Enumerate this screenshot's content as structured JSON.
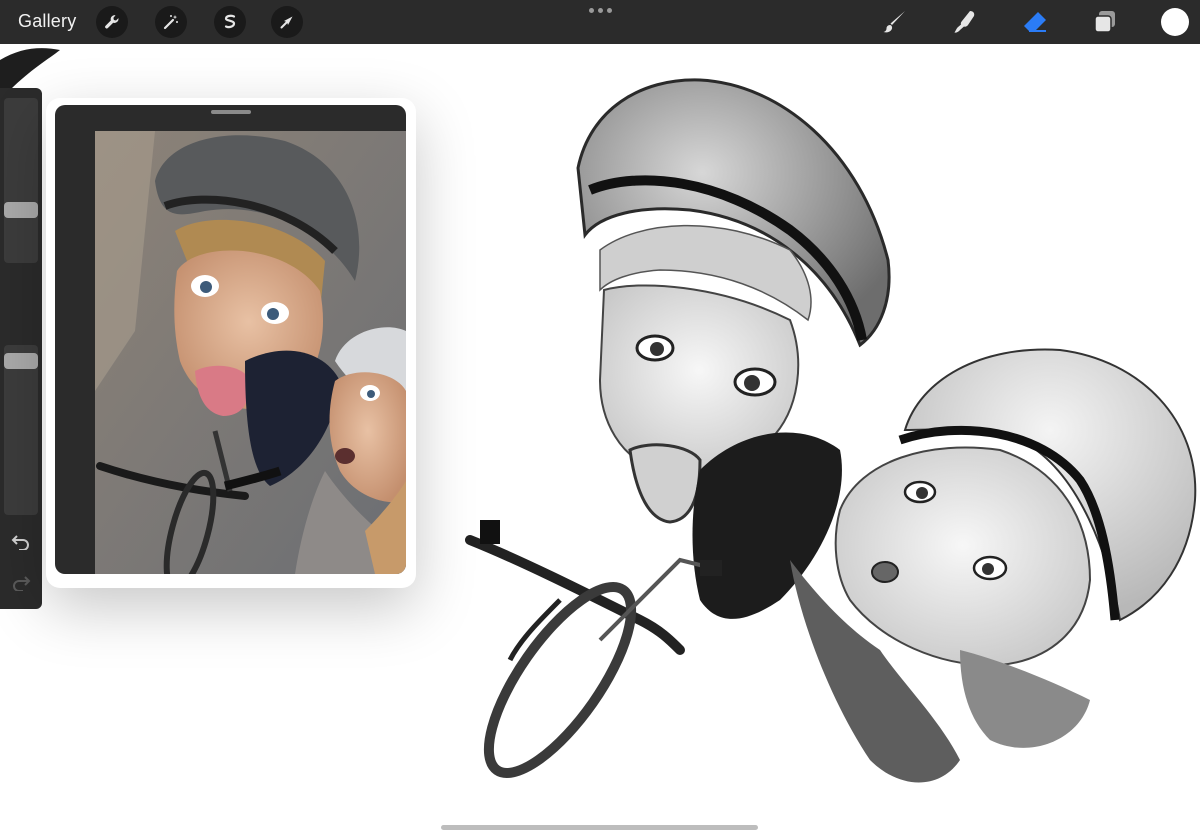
{
  "toolbar": {
    "gallery_label": "Gallery",
    "left_tools": [
      "wrench-icon",
      "magic-wand-icon",
      "selection-icon",
      "transform-arrow-icon"
    ],
    "right_tools": [
      "brush-icon",
      "smudge-icon",
      "eraser-icon",
      "layers-icon"
    ],
    "active_tool": "eraser-icon",
    "active_color": "#2b7cf6",
    "current_color": "#ffffff"
  },
  "sidebar": {
    "brush_size_level": 0.3,
    "opacity_level": 0.95
  },
  "reference": {
    "content": "photo"
  }
}
